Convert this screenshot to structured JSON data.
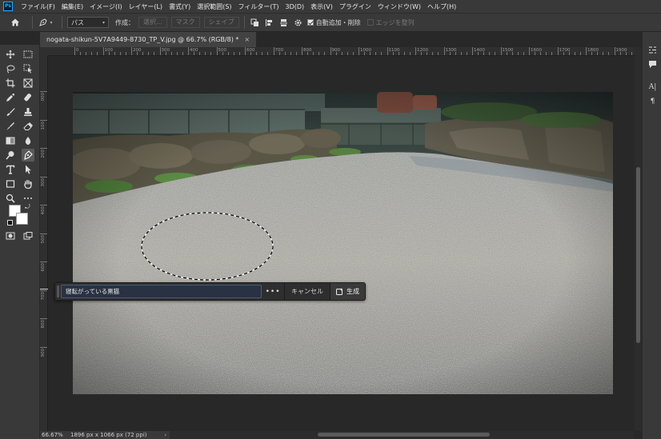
{
  "menubar": {
    "logo": "Ps",
    "items": [
      "ファイル(F)",
      "編集(E)",
      "イメージ(I)",
      "レイヤー(L)",
      "書式(Y)",
      "選択範囲(S)",
      "フィルター(T)",
      "3D(D)",
      "表示(V)",
      "プラグイン",
      "ウィンドウ(W)",
      "ヘルプ(H)"
    ]
  },
  "options": {
    "mode_value": "パス",
    "make_label": "作成：",
    "selection_btn": "選択...",
    "mask_btn": "マスク",
    "shape_btn": "シェイプ",
    "auto_add_delete": "自動追加・削除",
    "edge_align": "エッジを整列"
  },
  "document": {
    "tab_title": "nogata-shikun-5V7A9449-8730_TP_V.jpg @ 66.7% (RGB/8) *",
    "close": "×"
  },
  "rulers": {
    "top_ticks": [
      "0",
      "100",
      "200",
      "300",
      "400",
      "500",
      "600",
      "700",
      "800",
      "900",
      "1000",
      "1100",
      "1200",
      "1300",
      "1400",
      "1500",
      "1600",
      "1700",
      "1800",
      "1900"
    ],
    "left_ticks": [
      "0",
      "1",
      "2",
      "3",
      "4",
      "5",
      "6",
      "7",
      "8",
      "9"
    ]
  },
  "context_bar": {
    "prompt_value": "寝転がっている黒猫",
    "more": "•••",
    "cancel": "キャンセル",
    "generate": "生成"
  },
  "status": {
    "zoom": "66.67%",
    "dimensions": "1896 px x 1066 px (72 ppi)",
    "arrow": "›"
  },
  "colors": {
    "accent": "#31a8ff",
    "panel": "#393939",
    "workspace": "#282828"
  }
}
